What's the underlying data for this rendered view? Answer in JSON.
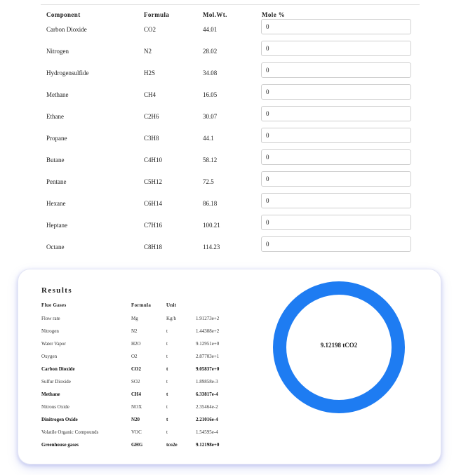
{
  "components": {
    "headers": {
      "component": "Component",
      "formula": "Formula",
      "mol_wt": "Mol.Wt.",
      "mole_pct": "Mole %"
    },
    "rows": [
      {
        "name": "Carbon Dioxide",
        "formula": "CO2",
        "mol_wt": "44.01",
        "mole_pct": "0"
      },
      {
        "name": "Nitrogen",
        "formula": "N2",
        "mol_wt": "28.02",
        "mole_pct": "0"
      },
      {
        "name": "Hydrogensulfide",
        "formula": "H2S",
        "mol_wt": "34.08",
        "mole_pct": "0"
      },
      {
        "name": "Methane",
        "formula": "CH4",
        "mol_wt": "16.05",
        "mole_pct": "0"
      },
      {
        "name": "Ethane",
        "formula": "C2H6",
        "mol_wt": "30.07",
        "mole_pct": "0"
      },
      {
        "name": "Propane",
        "formula": "C3H8",
        "mol_wt": "44.1",
        "mole_pct": "0"
      },
      {
        "name": "Butane",
        "formula": "C4H10",
        "mol_wt": "58.12",
        "mole_pct": "0"
      },
      {
        "name": "Pentane",
        "formula": "C5H12",
        "mol_wt": "72.5",
        "mole_pct": "0"
      },
      {
        "name": "Hexane",
        "formula": "C6H14",
        "mol_wt": "86.18",
        "mole_pct": "0"
      },
      {
        "name": "Heptane",
        "formula": "C7H16",
        "mol_wt": "100.21",
        "mole_pct": "0"
      },
      {
        "name": "Octane",
        "formula": "C8H18",
        "mol_wt": "114.23",
        "mole_pct": "0"
      }
    ]
  },
  "results": {
    "title": "Results",
    "headers": {
      "gas": "Flue Gases",
      "formula": "Formula",
      "unit": "Unit"
    },
    "rows": [
      {
        "gas": "Flow rate",
        "formula": "Mg",
        "unit": "Kg/h",
        "value": "1.91273e+2",
        "bold": false
      },
      {
        "gas": "Nitrogen",
        "formula": "N2",
        "unit": "t",
        "value": "1.44308e+2",
        "bold": false
      },
      {
        "gas": "Water Vapor",
        "formula": "H2O",
        "unit": "t",
        "value": "9.12951e+0",
        "bold": false
      },
      {
        "gas": "Oxygen",
        "formula": "O2",
        "unit": "t",
        "value": "2.87703e+1",
        "bold": false
      },
      {
        "gas": "Carbon Dioxide",
        "formula": "CO2",
        "unit": "t",
        "value": "9.05837e+0",
        "bold": true
      },
      {
        "gas": "Sulfur Dioxide",
        "formula": "SO2",
        "unit": "t",
        "value": "1.89858e-3",
        "bold": false
      },
      {
        "gas": "Methane",
        "formula": "CH4",
        "unit": "t",
        "value": "6.33817e-4",
        "bold": true
      },
      {
        "gas": "Nitrous Oxide",
        "formula": "NOX",
        "unit": "t",
        "value": "2.35464e-2",
        "bold": false
      },
      {
        "gas": "Dinitrogen Oxide",
        "formula": "N20",
        "unit": "t",
        "value": "2.21016e-4",
        "bold": true
      },
      {
        "gas": "Volatile Organic Compounds",
        "formula": "VOC",
        "unit": "t",
        "value": "1.54595e-4",
        "bold": false
      },
      {
        "gas": "Greenhouse gases",
        "formula": "GHG",
        "unit": "tco2e",
        "value": "9.12198e+0",
        "bold": true
      }
    ],
    "gauge": {
      "label": "9.12198 tCO2",
      "color": "#1e7cf2"
    }
  }
}
